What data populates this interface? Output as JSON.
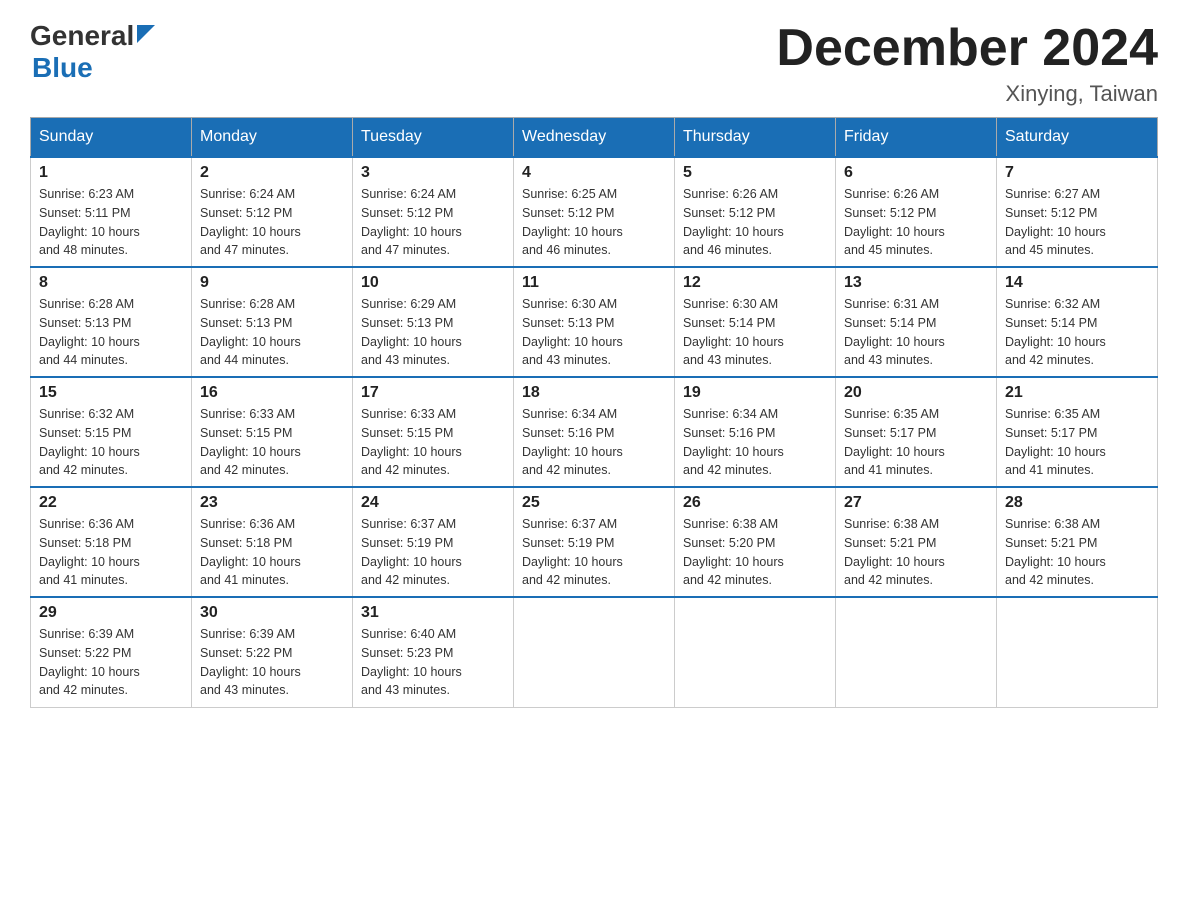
{
  "header": {
    "logo": {
      "general_text": "General",
      "blue_text": "Blue"
    },
    "title": "December 2024",
    "subtitle": "Xinying, Taiwan"
  },
  "days_of_week": [
    "Sunday",
    "Monday",
    "Tuesday",
    "Wednesday",
    "Thursday",
    "Friday",
    "Saturday"
  ],
  "weeks": [
    [
      {
        "day": "1",
        "sunrise": "6:23 AM",
        "sunset": "5:11 PM",
        "daylight": "10 hours and 48 minutes."
      },
      {
        "day": "2",
        "sunrise": "6:24 AM",
        "sunset": "5:12 PM",
        "daylight": "10 hours and 47 minutes."
      },
      {
        "day": "3",
        "sunrise": "6:24 AM",
        "sunset": "5:12 PM",
        "daylight": "10 hours and 47 minutes."
      },
      {
        "day": "4",
        "sunrise": "6:25 AM",
        "sunset": "5:12 PM",
        "daylight": "10 hours and 46 minutes."
      },
      {
        "day": "5",
        "sunrise": "6:26 AM",
        "sunset": "5:12 PM",
        "daylight": "10 hours and 46 minutes."
      },
      {
        "day": "6",
        "sunrise": "6:26 AM",
        "sunset": "5:12 PM",
        "daylight": "10 hours and 45 minutes."
      },
      {
        "day": "7",
        "sunrise": "6:27 AM",
        "sunset": "5:12 PM",
        "daylight": "10 hours and 45 minutes."
      }
    ],
    [
      {
        "day": "8",
        "sunrise": "6:28 AM",
        "sunset": "5:13 PM",
        "daylight": "10 hours and 44 minutes."
      },
      {
        "day": "9",
        "sunrise": "6:28 AM",
        "sunset": "5:13 PM",
        "daylight": "10 hours and 44 minutes."
      },
      {
        "day": "10",
        "sunrise": "6:29 AM",
        "sunset": "5:13 PM",
        "daylight": "10 hours and 43 minutes."
      },
      {
        "day": "11",
        "sunrise": "6:30 AM",
        "sunset": "5:13 PM",
        "daylight": "10 hours and 43 minutes."
      },
      {
        "day": "12",
        "sunrise": "6:30 AM",
        "sunset": "5:14 PM",
        "daylight": "10 hours and 43 minutes."
      },
      {
        "day": "13",
        "sunrise": "6:31 AM",
        "sunset": "5:14 PM",
        "daylight": "10 hours and 43 minutes."
      },
      {
        "day": "14",
        "sunrise": "6:32 AM",
        "sunset": "5:14 PM",
        "daylight": "10 hours and 42 minutes."
      }
    ],
    [
      {
        "day": "15",
        "sunrise": "6:32 AM",
        "sunset": "5:15 PM",
        "daylight": "10 hours and 42 minutes."
      },
      {
        "day": "16",
        "sunrise": "6:33 AM",
        "sunset": "5:15 PM",
        "daylight": "10 hours and 42 minutes."
      },
      {
        "day": "17",
        "sunrise": "6:33 AM",
        "sunset": "5:15 PM",
        "daylight": "10 hours and 42 minutes."
      },
      {
        "day": "18",
        "sunrise": "6:34 AM",
        "sunset": "5:16 PM",
        "daylight": "10 hours and 42 minutes."
      },
      {
        "day": "19",
        "sunrise": "6:34 AM",
        "sunset": "5:16 PM",
        "daylight": "10 hours and 42 minutes."
      },
      {
        "day": "20",
        "sunrise": "6:35 AM",
        "sunset": "5:17 PM",
        "daylight": "10 hours and 41 minutes."
      },
      {
        "day": "21",
        "sunrise": "6:35 AM",
        "sunset": "5:17 PM",
        "daylight": "10 hours and 41 minutes."
      }
    ],
    [
      {
        "day": "22",
        "sunrise": "6:36 AM",
        "sunset": "5:18 PM",
        "daylight": "10 hours and 41 minutes."
      },
      {
        "day": "23",
        "sunrise": "6:36 AM",
        "sunset": "5:18 PM",
        "daylight": "10 hours and 41 minutes."
      },
      {
        "day": "24",
        "sunrise": "6:37 AM",
        "sunset": "5:19 PM",
        "daylight": "10 hours and 42 minutes."
      },
      {
        "day": "25",
        "sunrise": "6:37 AM",
        "sunset": "5:19 PM",
        "daylight": "10 hours and 42 minutes."
      },
      {
        "day": "26",
        "sunrise": "6:38 AM",
        "sunset": "5:20 PM",
        "daylight": "10 hours and 42 minutes."
      },
      {
        "day": "27",
        "sunrise": "6:38 AM",
        "sunset": "5:21 PM",
        "daylight": "10 hours and 42 minutes."
      },
      {
        "day": "28",
        "sunrise": "6:38 AM",
        "sunset": "5:21 PM",
        "daylight": "10 hours and 42 minutes."
      }
    ],
    [
      {
        "day": "29",
        "sunrise": "6:39 AM",
        "sunset": "5:22 PM",
        "daylight": "10 hours and 42 minutes."
      },
      {
        "day": "30",
        "sunrise": "6:39 AM",
        "sunset": "5:22 PM",
        "daylight": "10 hours and 43 minutes."
      },
      {
        "day": "31",
        "sunrise": "6:40 AM",
        "sunset": "5:23 PM",
        "daylight": "10 hours and 43 minutes."
      },
      null,
      null,
      null,
      null
    ]
  ],
  "labels": {
    "sunrise": "Sunrise:",
    "sunset": "Sunset:",
    "daylight": "Daylight:"
  }
}
